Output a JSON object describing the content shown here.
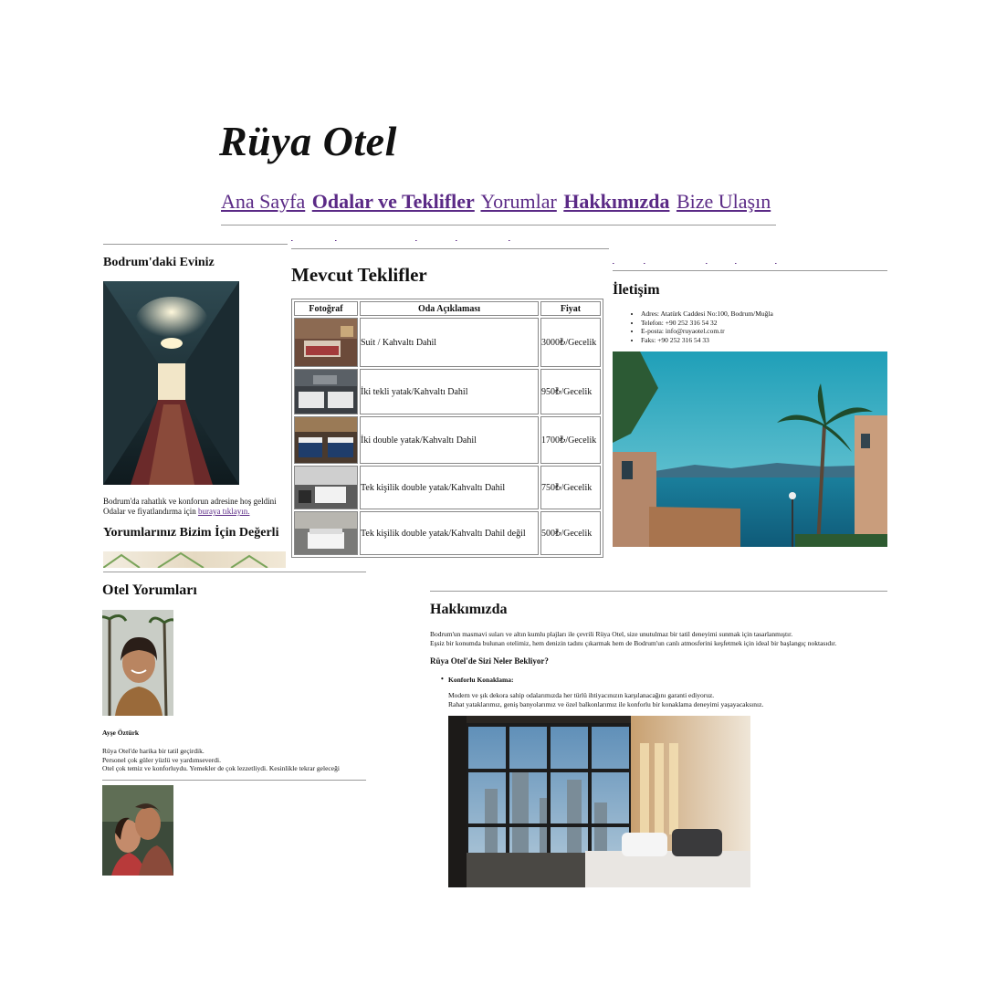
{
  "header": {
    "site_title": "Rüya Otel",
    "nav": [
      {
        "label": "Ana Sayfa",
        "bold": false
      },
      {
        "label": "Odalar ve Teklifler",
        "bold": true
      },
      {
        "label": "Yorumlar",
        "bold": false
      },
      {
        "label": "Hakkımızda",
        "bold": true
      },
      {
        "label": "Bize Ulaşın",
        "bold": false
      }
    ]
  },
  "left_panel": {
    "heading": "Bodrum'daki Eviniz",
    "intro_line1": "Bodrum'da rahatlık ve konforun adresine hoş geldini",
    "intro_line2_prefix": "Odalar ve fiyatlandırma için ",
    "intro_link": "buraya tıklayın.",
    "reviews_heading": "Yorumlarınız Bizim İçin Değerli"
  },
  "offers": {
    "heading": "Mevcut Teklifler",
    "columns": [
      "Fotoğraf",
      "Oda Açıklaması",
      "Fiyat"
    ],
    "rows": [
      {
        "description": "Suit / Kahvaltı Dahil",
        "price": "3000₺/Gecelik"
      },
      {
        "description": "İki tekli yatak/Kahvaltı Dahil",
        "price": "950₺/Gecelik"
      },
      {
        "description": "İki double yatak/Kahvaltı Dahil",
        "price": "1700₺/Gecelik"
      },
      {
        "description": "Tek kişilik double yatak/Kahvaltı Dahil",
        "price": "750₺/Gecelik"
      },
      {
        "description": "Tek kişilik double yatak/Kahvaltı Dahil değil",
        "price": "500₺/Gecelik"
      }
    ]
  },
  "contact": {
    "heading": "İletişim",
    "items": [
      "Adres: Atatürk Caddesi No:100, Bodrum/Muğla",
      "Telefon: +90 252 316 54 32",
      "E-posta: info@ruyaotel.com.tr",
      "Faks: +90 252 316 54 33"
    ]
  },
  "reviews": {
    "heading": "Otel Yorumları",
    "reviewer_name": "Ayşe Öztürk",
    "lines": [
      "Rüya Otel'de harika bir tatil geçirdik.",
      "Personel çok güler yüzlü ve yardımseverdi.",
      "Otel çok temiz ve konforluydu. Yemekler de çok lezzetliydi. Kesinlikle tekrar geleceği"
    ]
  },
  "about": {
    "heading": "Hakkımızda",
    "para_line1": "Bodrum'un masmavi suları ve altın kumlu plajları ile çevrili Rüya Otel, size unutulmaz bir tatil deneyimi sunmak için tasarlanmıştır.",
    "para_line2": "Eşsiz bir konumda bulunan otelimiz, hem denizin tadını çıkarmak hem de Bodrum'un canlı atmosferini keşfetmek için ideal bir başlangıç noktasıdır.",
    "subheading": "Rüya Otel'de Sizi Neler Bekliyor?",
    "bullet_title": "Konforlu Konaklama:",
    "bullet_line1": "Modern ve şık dekora sahip odalarımızda her türlü ihtiyacınızın karşılanacağını garanti ediyoruz.",
    "bullet_line2": "Rahat yataklarımız, geniş banyolarımız ve özel balkonlarımız ile konforlu bir konaklama deneyimi yaşayacaksınız."
  },
  "colors": {
    "link": "#5b2a86",
    "sea": "#1b8aa5",
    "sky": "#36a9c0"
  }
}
